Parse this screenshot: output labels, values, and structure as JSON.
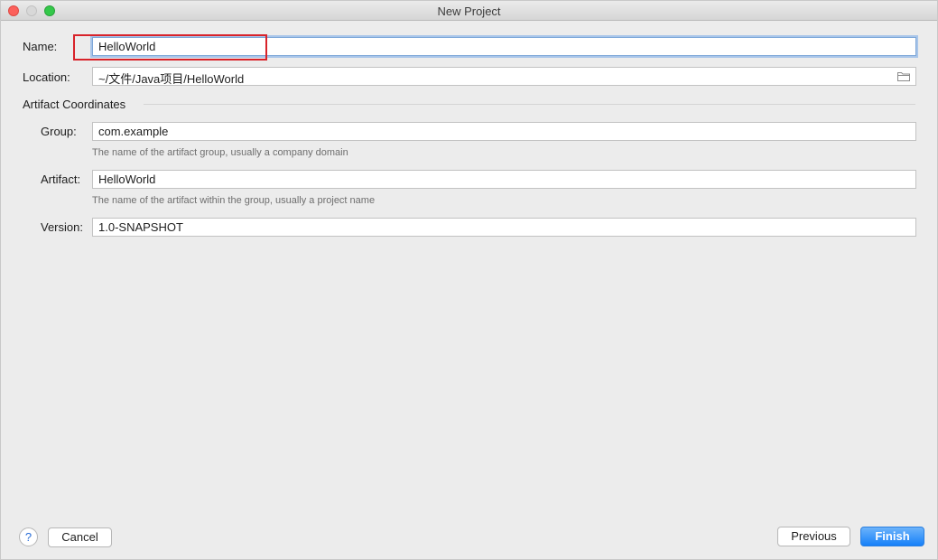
{
  "window": {
    "title": "New Project"
  },
  "form": {
    "name_label": "Name:",
    "name_value": "HelloWorld",
    "location_label": "Location:",
    "location_value": "~/文件/Java项目/HelloWorld",
    "section_title": "Artifact Coordinates",
    "group_label": "Group:",
    "group_value": "com.example",
    "group_hint": "The name of the artifact group, usually a company domain",
    "artifact_label": "Artifact:",
    "artifact_value": "HelloWorld",
    "artifact_hint": "The name of the artifact within the group, usually a project name",
    "version_label": "Version:",
    "version_value": "1.0-SNAPSHOT"
  },
  "footer": {
    "help_label": "?",
    "cancel_label": "Cancel",
    "previous_label": "Previous",
    "finish_label": "Finish"
  },
  "icons": {
    "folder": "folder-icon",
    "help": "help-icon"
  },
  "colors": {
    "highlight_box": "#d8232a",
    "primary_button": "#1680f9",
    "focus_ring": "#a9c6ea"
  }
}
